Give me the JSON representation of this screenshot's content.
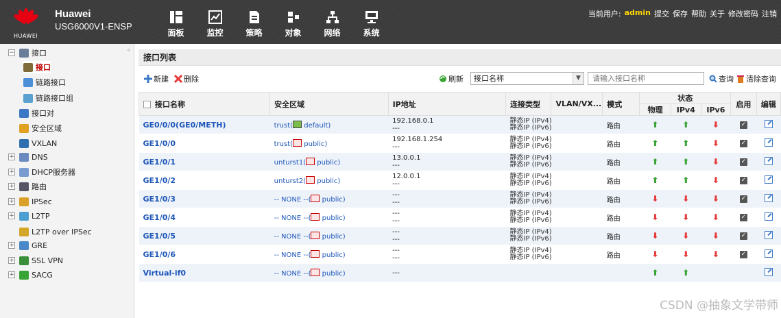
{
  "header": {
    "brand_name": "Huawei",
    "device_name": "USG6000V1-ENSP",
    "logo_text": "HUAWEI",
    "nav": [
      {
        "label": "面板",
        "icon": "dashboard-icon"
      },
      {
        "label": "监控",
        "icon": "monitor-chart-icon"
      },
      {
        "label": "策略",
        "icon": "policy-document-icon"
      },
      {
        "label": "对象",
        "icon": "object-icon"
      },
      {
        "label": "网络",
        "icon": "network-topology-icon"
      },
      {
        "label": "系统",
        "icon": "system-computer-icon"
      }
    ],
    "current_user_label": "当前用户:",
    "current_user": "admin",
    "links": [
      "提交",
      "保存",
      "帮助",
      "关于",
      "修改密码",
      "注销"
    ]
  },
  "sidebar": {
    "items": [
      {
        "label": "接口",
        "expand": "−",
        "icon": "interface-icon"
      },
      {
        "label": "接口",
        "icon": "interface-icon",
        "selected": true
      },
      {
        "label": "链路接口",
        "icon": "link-interface-icon"
      },
      {
        "label": "链路接口组",
        "icon": "link-group-icon"
      },
      {
        "label": "接口对",
        "icon": "interface-pair-icon"
      },
      {
        "label": "安全区域",
        "icon": "security-zone-icon"
      },
      {
        "label": "VXLAN",
        "icon": "vxlan-icon"
      },
      {
        "label": "DNS",
        "expand": "+",
        "icon": "dns-icon"
      },
      {
        "label": "DHCP服务器",
        "expand": "+",
        "icon": "dhcp-icon"
      },
      {
        "label": "路由",
        "expand": "+",
        "icon": "route-icon"
      },
      {
        "label": "IPSec",
        "expand": "+",
        "icon": "ipsec-icon"
      },
      {
        "label": "L2TP",
        "expand": "+",
        "icon": "l2tp-icon"
      },
      {
        "label": "L2TP over IPSec",
        "icon": "l2tp-ipsec-icon"
      },
      {
        "label": "GRE",
        "expand": "+",
        "icon": "gre-icon"
      },
      {
        "label": "SSL VPN",
        "expand": "+",
        "icon": "sslvpn-icon"
      },
      {
        "label": "SACG",
        "expand": "+",
        "icon": "sacg-icon"
      }
    ]
  },
  "main": {
    "title": "接口列表",
    "toolbar": {
      "new_label": "新建",
      "delete_label": "删除",
      "refresh_label": "刷新",
      "filter_field": "接口名称",
      "search_placeholder": "请输入接口名称",
      "query_label": "查询",
      "clear_label": "清除查询"
    },
    "columns": {
      "name": "接口名称",
      "zone": "安全区域",
      "ip": "IP地址",
      "conn_type": "连接类型",
      "vlan": "VLAN/VX...",
      "mode": "模式",
      "status": "状态",
      "physical": "物理",
      "ipv4": "IPv4",
      "ipv6": "IPv6",
      "enable": "启用",
      "edit": "编辑"
    },
    "rows": [
      {
        "name": "GE0/0/0(GE0/METH)",
        "zone_prefix": "trust(",
        "zone_suffix": " default)",
        "zone_icon": "green",
        "ip1": "192.168.0.1",
        "ip2": "---",
        "conn1": "静态IP (IPv4)",
        "conn2": "静态IP (IPv6)",
        "mode": "路由",
        "phy": "up",
        "v4": "up",
        "v6": "down",
        "enabled": true
      },
      {
        "name": "GE1/0/0",
        "zone_prefix": "trust(",
        "zone_suffix": " public)",
        "zone_icon": "red",
        "ip1": "192.168.1.254",
        "ip2": "---",
        "conn1": "静态IP (IPv4)",
        "conn2": "静态IP (IPv6)",
        "mode": "路由",
        "phy": "up",
        "v4": "up",
        "v6": "down",
        "enabled": true
      },
      {
        "name": "GE1/0/1",
        "zone_prefix": "unturst1(",
        "zone_suffix": " public)",
        "zone_icon": "red",
        "ip1": "13.0.0.1",
        "ip2": "---",
        "conn1": "静态IP (IPv4)",
        "conn2": "静态IP (IPv6)",
        "mode": "路由",
        "phy": "up",
        "v4": "up",
        "v6": "down",
        "enabled": true
      },
      {
        "name": "GE1/0/2",
        "zone_prefix": "unturst2(",
        "zone_suffix": " public)",
        "zone_icon": "red",
        "ip1": "12.0.0.1",
        "ip2": "---",
        "conn1": "静态IP (IPv4)",
        "conn2": "静态IP (IPv6)",
        "mode": "路由",
        "phy": "up",
        "v4": "up",
        "v6": "down",
        "enabled": true
      },
      {
        "name": "GE1/0/3",
        "zone_prefix": "-- NONE --(",
        "zone_suffix": " public)",
        "zone_icon": "red",
        "ip1": "---",
        "ip2": "---",
        "conn1": "静态IP (IPv4)",
        "conn2": "静态IP (IPv6)",
        "mode": "路由",
        "phy": "down",
        "v4": "down",
        "v6": "down",
        "enabled": true
      },
      {
        "name": "GE1/0/4",
        "zone_prefix": "-- NONE --(",
        "zone_suffix": " public)",
        "zone_icon": "red",
        "ip1": "---",
        "ip2": "---",
        "conn1": "静态IP (IPv4)",
        "conn2": "静态IP (IPv6)",
        "mode": "路由",
        "phy": "down",
        "v4": "down",
        "v6": "down",
        "enabled": true
      },
      {
        "name": "GE1/0/5",
        "zone_prefix": "-- NONE --(",
        "zone_suffix": " public)",
        "zone_icon": "red",
        "ip1": "---",
        "ip2": "---",
        "conn1": "静态IP (IPv4)",
        "conn2": "静态IP (IPv6)",
        "mode": "路由",
        "phy": "down",
        "v4": "down",
        "v6": "down",
        "enabled": true
      },
      {
        "name": "GE1/0/6",
        "zone_prefix": "-- NONE --(",
        "zone_suffix": " public)",
        "zone_icon": "red",
        "ip1": "---",
        "ip2": "---",
        "conn1": "静态IP (IPv4)",
        "conn2": "静态IP (IPv6)",
        "mode": "路由",
        "phy": "down",
        "v4": "down",
        "v6": "down",
        "enabled": true
      },
      {
        "name": "Virtual-if0",
        "zone_prefix": "-- NONE --(",
        "zone_suffix": " public)",
        "zone_icon": "red",
        "ip1": "---",
        "ip2": "",
        "conn1": "",
        "conn2": "",
        "mode": "",
        "phy": "up",
        "v4": "up",
        "v6": "",
        "enabled": false
      }
    ]
  },
  "watermark": "CSDN @抽象文学带师",
  "colors": {
    "header_bg": "#3a3a3a",
    "link_blue": "#1d56b8",
    "status_up": "#3aa335",
    "status_down": "#e53b3b",
    "username": "#ffd800"
  }
}
